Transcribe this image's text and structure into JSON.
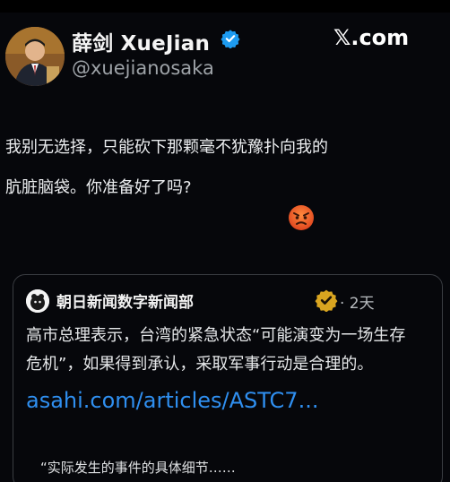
{
  "author": {
    "display_name": "薛剑 XueJian",
    "handle": "@xuejianosaka",
    "verified_badge_color": "#1d9bf0"
  },
  "brand": {
    "x_logo_text": "𝕏.com"
  },
  "tweet": {
    "line1": "我别无选择，只能砍下那颗毫不犹豫扑向我的",
    "line2": "肮脏脑袋。你准备好了吗?",
    "emoji": "angry-face"
  },
  "quote": {
    "source_name": "朝日新闻数字新闻部",
    "gold_badge_color": "#d9a520",
    "age": "· 2天",
    "body_line1": "高市总理表示，台湾的紧急状态“可能演变为一场生存",
    "body_line2": "危机”，如果得到承认，采取军事行动是合理的。",
    "link": "asahi.com/articles/ASTC7...",
    "link_color": "#2f8ff0",
    "note": "“实际发生的事件的具体细节……"
  }
}
